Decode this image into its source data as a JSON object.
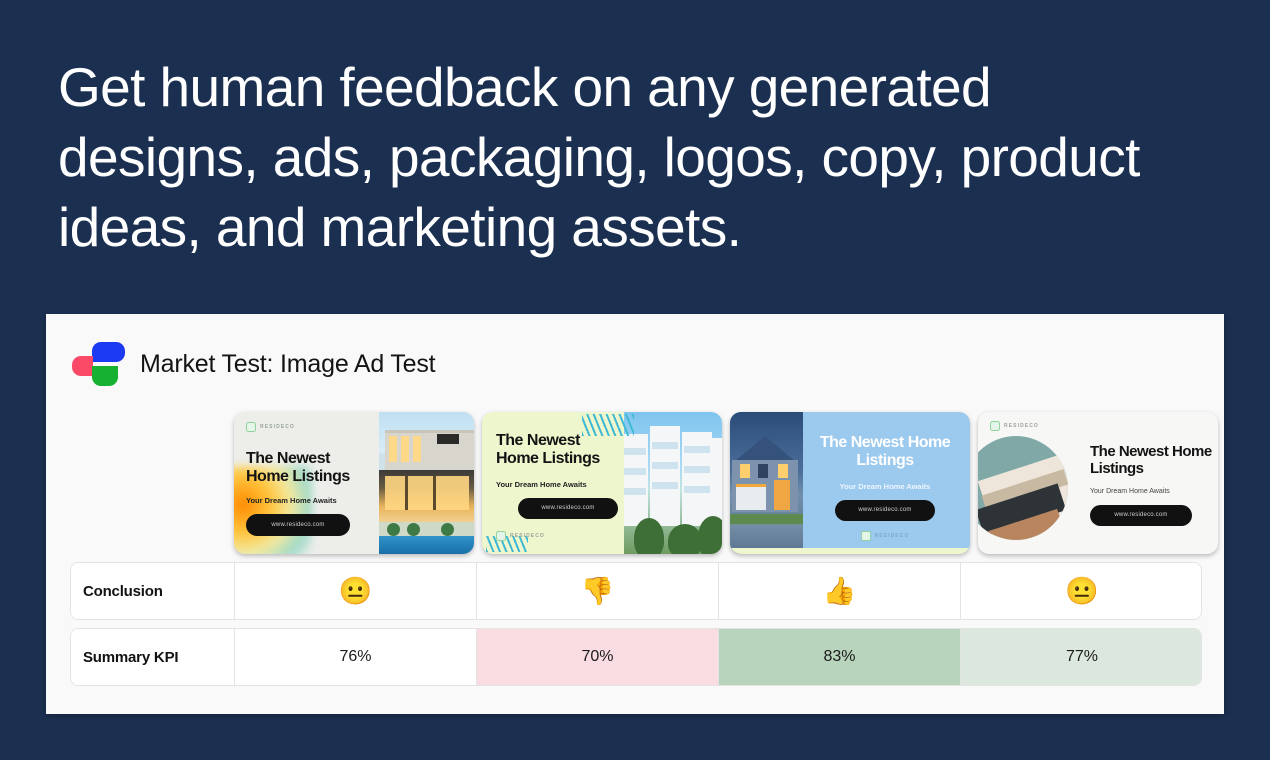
{
  "theme": {
    "background": "#1b3051",
    "panel_bg": "#f9f9f9",
    "headline_color": "#ffffff"
  },
  "headline": {
    "text": "Get human feedback on any generated designs, ads, packaging, logos, copy, product ideas, and marketing assets."
  },
  "panel": {
    "title": "Market Test: Image Ad Test",
    "logo": {
      "name": "brand-logo",
      "colors": [
        "#1b39f0",
        "#fb4a68",
        "#16b131"
      ]
    }
  },
  "ads": [
    {
      "id": "ad-1",
      "brand": "RESIDECO",
      "headline": "The Newest Home Listings",
      "subhead": "Your Dream Home Awaits",
      "cta": "www.resideco.com",
      "bg": "#edeeea",
      "layout": "text-left-photo-right"
    },
    {
      "id": "ad-2",
      "brand": "RESIDECO",
      "headline": "The Newest Home Listings",
      "subhead": "Your Dream Home Awaits",
      "cta": "www.resideco.com",
      "bg": "#eef6cd",
      "layout": "text-left-photo-right"
    },
    {
      "id": "ad-3",
      "brand": "RESIDECO",
      "headline": "The Newest Home Listings",
      "subhead": "Your Dream Home Awaits",
      "cta": "www.resideco.com",
      "bg": "#9cc9ee",
      "layout": "photo-left-text-right"
    },
    {
      "id": "ad-4",
      "brand": "RESIDECO",
      "headline": "The Newest Home Listings",
      "subhead": "Your Dream Home Awaits",
      "cta": "www.resideco.com",
      "bg": "#f7f7f5",
      "layout": "photo-left-text-right"
    }
  ],
  "table": {
    "rows": [
      {
        "label": "Conclusion",
        "cells": [
          {
            "emoji": "😐",
            "icon": "neutral-face-emoji",
            "bg": "#ffffff"
          },
          {
            "emoji": "👎",
            "icon": "thumbs-down-emoji",
            "bg": "#ffffff"
          },
          {
            "emoji": "👍",
            "icon": "thumbs-up-emoji",
            "bg": "#ffffff"
          },
          {
            "emoji": "😐",
            "icon": "neutral-face-emoji",
            "bg": "#ffffff"
          }
        ]
      },
      {
        "label": "Summary KPI",
        "cells": [
          {
            "value": "76%",
            "bg": "#ffffff"
          },
          {
            "value": "70%",
            "bg": "#f9dde2"
          },
          {
            "value": "83%",
            "bg": "#b9d4bc"
          },
          {
            "value": "77%",
            "bg": "#dce8dd"
          }
        ]
      }
    ]
  }
}
